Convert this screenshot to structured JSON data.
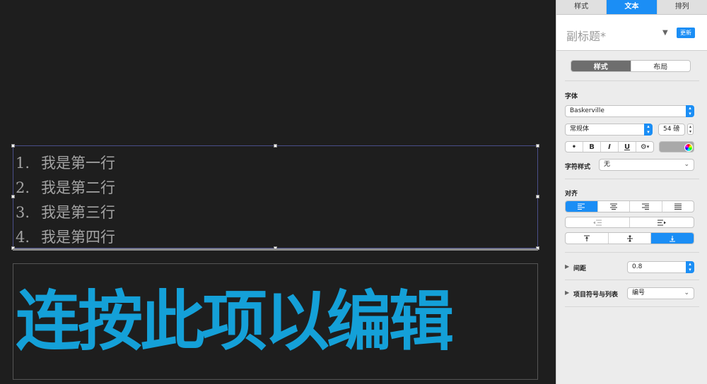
{
  "canvas": {
    "list_items": [
      {
        "num": "1.",
        "text": "我是第一行"
      },
      {
        "num": "2.",
        "text": "我是第二行"
      },
      {
        "num": "3.",
        "text": "我是第三行"
      },
      {
        "num": "4.",
        "text": "我是第四行"
      }
    ],
    "body_text": "连按此项以编辑",
    "body_text_color": "#14a0d8"
  },
  "inspector": {
    "tabs": [
      {
        "label": "样式",
        "active": false
      },
      {
        "label": "文本",
        "active": true
      },
      {
        "label": "排列",
        "active": false
      }
    ],
    "paragraph_style": "副标题*",
    "update_label": "更新",
    "mode_segments": [
      "样式",
      "布局"
    ],
    "font_section_label": "字体",
    "font_family": "Baskerville",
    "font_typeface": "常规体",
    "font_size": "54 磅",
    "format_buttons": [
      "•",
      "B",
      "I",
      "U",
      "U"
    ],
    "gear_label": "⚙",
    "char_style_label": "字符样式",
    "char_style_value": "无",
    "align_section_label": "对齐",
    "spacing_label": "间距",
    "spacing_value": "0.8",
    "bullets_label": "项目符号与列表",
    "bullets_value": "编号",
    "accent_color": "#1b8ef5"
  }
}
